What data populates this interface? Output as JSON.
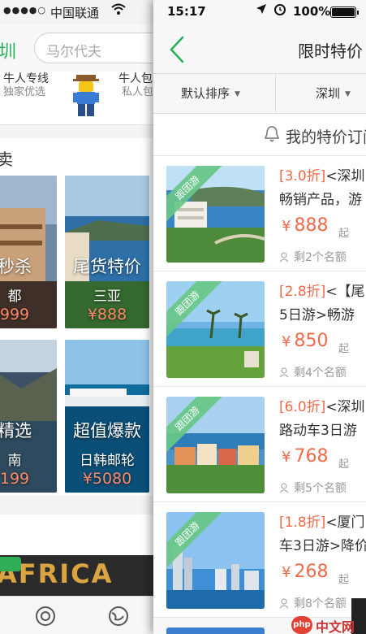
{
  "background_page": {
    "status": {
      "signal": "●●●●○",
      "carrier": "中国联通",
      "wifi_icon": "wifi-icon"
    },
    "city": "圳",
    "search_placeholder": "马尔代夫",
    "strip": {
      "left_title": "牛人专线",
      "left_sub": "独家优选",
      "right_title": "牛人包",
      "right_sub": "私人包"
    },
    "section_title": "卖",
    "tiles": [
      {
        "label": "秒杀",
        "sub": "都",
        "price": "999"
      },
      {
        "label": "尾货特价",
        "sub": "三亚",
        "price": "¥888"
      },
      {
        "label": "精选",
        "sub": "南",
        "price": "199"
      },
      {
        "label": "超值爆款",
        "sub": "日韩邮轮",
        "price": "¥5080"
      }
    ],
    "bottom_banner_text": "AFRICA"
  },
  "status_bar": {
    "time": "15:17",
    "battery": "100%"
  },
  "header": {
    "title": "限时特价"
  },
  "filters": {
    "sort": "默认排序",
    "city": "深圳"
  },
  "subscribe": {
    "text": "我的特价订阅"
  },
  "ribbon_text": "跟团游",
  "items": [
    {
      "discount": "[3.0折]",
      "title": "<深圳出发",
      "subtitle": "畅销产品，游",
      "price": "888",
      "qi": "起",
      "remain": "剩2个名额"
    },
    {
      "discount": "[2.8折]",
      "title": "<【尾",
      "subtitle": "5日游>畅游",
      "price": "850",
      "qi": "起",
      "remain": "剩4个名额"
    },
    {
      "discount": "[6.0折]",
      "title": "<深圳出发",
      "subtitle": "路动车3日游",
      "price": "768",
      "qi": "起",
      "remain": "剩5个名额"
    },
    {
      "discount": "[1.8折]",
      "title": "<厦门",
      "subtitle": "车3日游>降价",
      "price": "268",
      "qi": "起",
      "remain": "剩8个名额"
    }
  ],
  "watermark": {
    "badge": "php",
    "text": "中文网"
  }
}
